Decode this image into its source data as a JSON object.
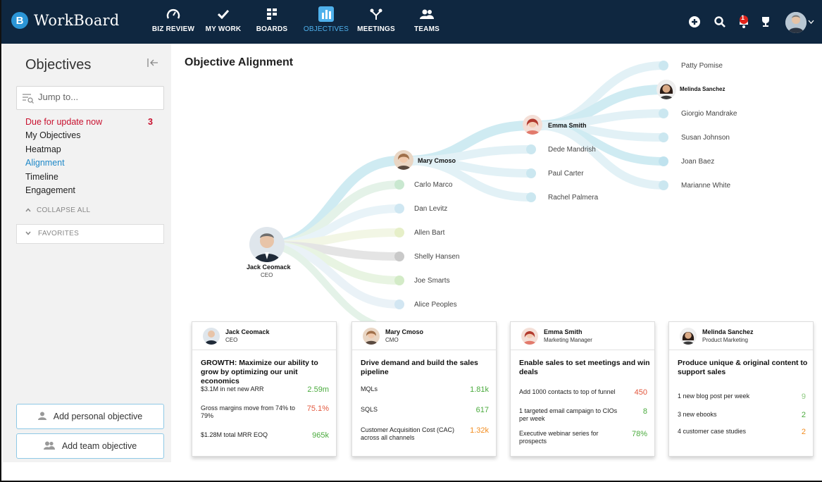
{
  "app": {
    "name": "WorkBoard",
    "logo_letter": "B"
  },
  "nav": [
    {
      "label": "BIZ REVIEW",
      "icon": "gauge-icon"
    },
    {
      "label": "MY WORK",
      "icon": "checkmark-icon"
    },
    {
      "label": "BOARDS",
      "icon": "boards-icon"
    },
    {
      "label": "OBJECTIVES",
      "icon": "bar-chart-icon",
      "active": true
    },
    {
      "label": "MEETINGS",
      "icon": "meetings-icon"
    },
    {
      "label": "TEAMS",
      "icon": "teams-icon"
    }
  ],
  "header_right": {
    "notification_count": "1",
    "icons": [
      "add-icon",
      "search-icon",
      "notification-icon",
      "trophy-icon",
      "user-avatar",
      "chevron-down-icon"
    ]
  },
  "sidebar": {
    "title": "Objectives",
    "search_placeholder": "Jump to...",
    "items": [
      {
        "label": "Due for update now",
        "count": "3",
        "style": "alert"
      },
      {
        "label": "My Objectives"
      },
      {
        "label": "Heatmap"
      },
      {
        "label": "Alignment",
        "style": "active"
      },
      {
        "label": "Timeline"
      },
      {
        "label": "Engagement"
      }
    ],
    "collapse_all": "COLLAPSE ALL",
    "favorites": "FAVORITES",
    "add_personal": "Add personal objective",
    "add_team": "Add team objective"
  },
  "main": {
    "title": "Objective Alignment",
    "root": {
      "name": "Jack Ceomack",
      "role": "CEO"
    },
    "level1_people": [
      "Mary Cmoso",
      "Carlo Marco",
      "Dan Levitz",
      "Allen Bart",
      "Shelly Hansen",
      "Joe Smarts",
      "Alice Peoples"
    ],
    "level2_people": [
      "Emma Smith",
      "Dede Mandrish",
      "Paul Carter",
      "Rachel Palmera"
    ],
    "level3_people": [
      "Patty Pomise",
      "Melinda Sanchez",
      "Giorgio Mandrake",
      "Susan Johnson",
      "Joan Baez",
      "Marianne White"
    ]
  },
  "colors": {
    "topbar": "#0f2740",
    "accent": "#4fb1ec",
    "alert": "#c8102e",
    "good": "#4bab3e",
    "warn": "#f28c1e",
    "bad": "#e3583e"
  },
  "cards": [
    {
      "name": "Jack Ceomack",
      "role": "CEO",
      "objective": "GROWTH: Maximize our ability to grow by optimizing our unit economics",
      "key_results": [
        {
          "text": "$3.1M in net new ARR",
          "value": "2.59m",
          "status": "green"
        },
        {
          "text": "Gross margins move from 74% to 79%",
          "value": "75.1%",
          "status": "red"
        },
        {
          "text": "$1.28M total MRR EOQ",
          "value": "965k",
          "status": "green"
        }
      ]
    },
    {
      "name": "Mary Cmoso",
      "role": "CMO",
      "objective": "Drive demand and build the sales pipeline",
      "key_results": [
        {
          "text": "MQLs",
          "value": "1.81k",
          "status": "green"
        },
        {
          "text": "SQLS",
          "value": "617",
          "status": "green"
        },
        {
          "text": "Customer Acquisition Cost (CAC) across all channels",
          "value": "1.32k",
          "status": "orange"
        }
      ]
    },
    {
      "name": "Emma Smith",
      "role": "Marketing Manager",
      "objective": "Enable sales to set meetings and win deals",
      "key_results": [
        {
          "text": "Add 1000 contacts to top of funnel",
          "value": "450",
          "status": "red"
        },
        {
          "text": "1 targeted email campaign to CIOs per week",
          "value": "8",
          "status": "green"
        },
        {
          "text": "Executive webinar series for prospects",
          "value": "78%",
          "status": "green"
        }
      ]
    },
    {
      "name": "Melinda Sanchez",
      "role": "Product Marketing",
      "objective": "Produce unique & original content to support sales",
      "key_results": [
        {
          "text": "1 new blog post per week",
          "value": "9",
          "status": "green"
        },
        {
          "text": "3 new ebooks",
          "value": "2",
          "status": "green"
        },
        {
          "text": "4 customer case studies",
          "value": "2",
          "status": "orange"
        }
      ]
    }
  ]
}
